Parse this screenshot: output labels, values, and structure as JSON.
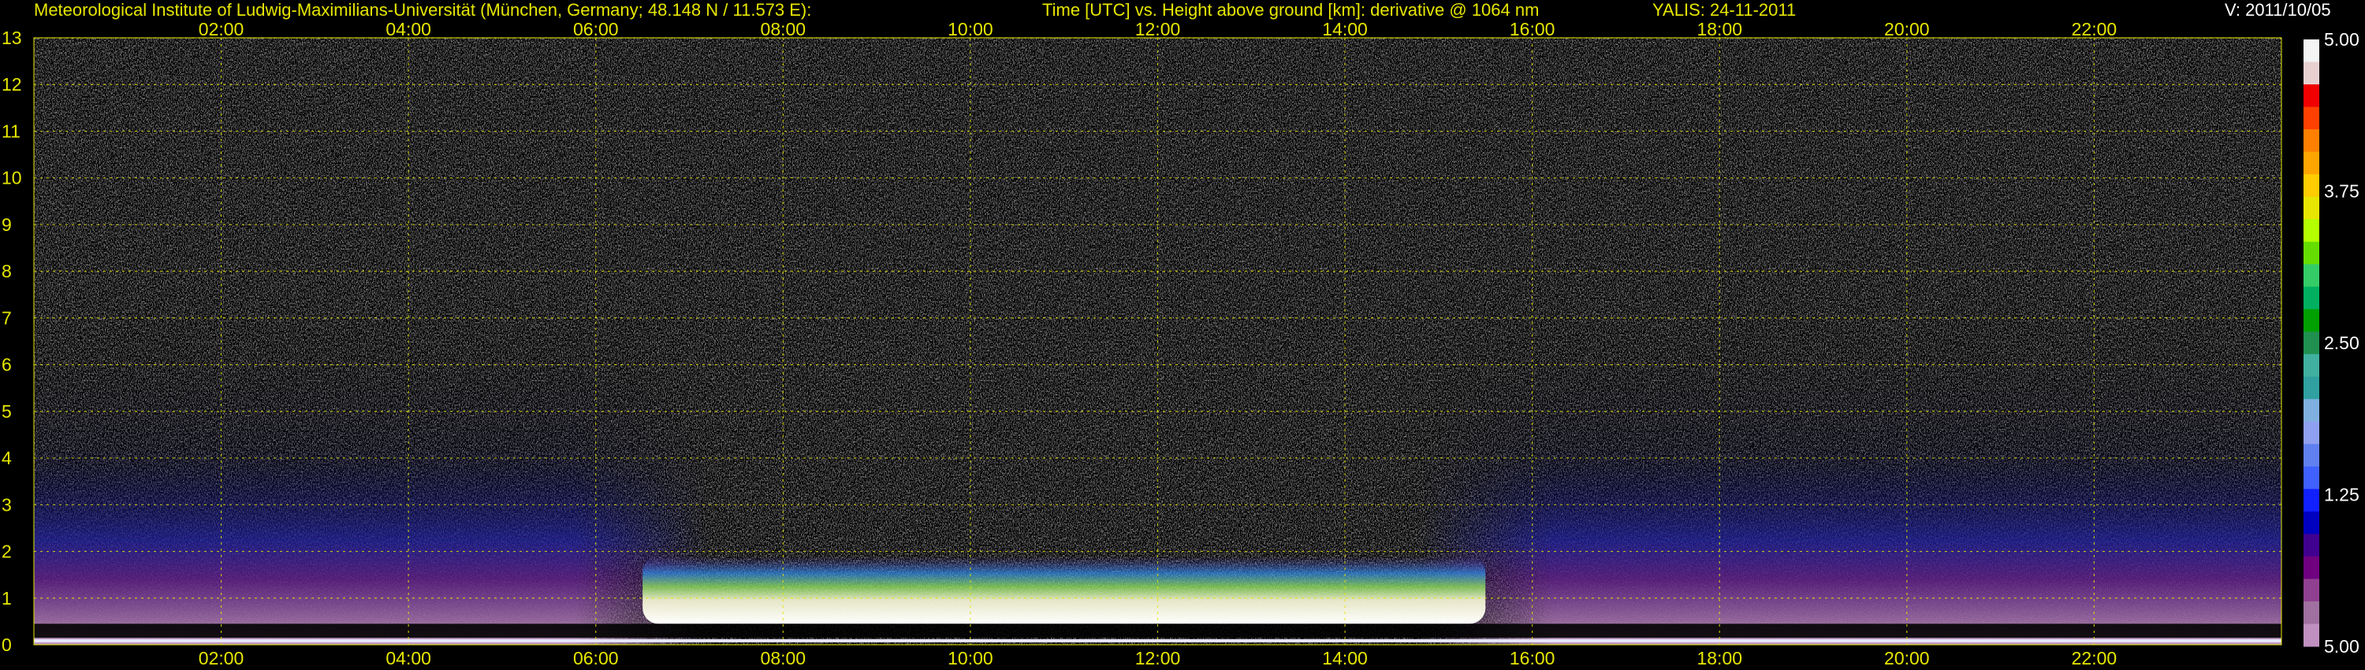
{
  "header": {
    "institute": "Meteorological Institute of Ludwig-Maximilians-Universität (München, Germany; 48.148 N / 11.573 E):",
    "description": "Time [UTC] vs. Height above ground [km]: derivative @ 1064 nm",
    "instrument_date": "YALIS: 24-11-2011",
    "version": "V: 2011/10/05"
  },
  "chart_data": {
    "type": "heatmap",
    "title": "Time [UTC] vs. Height above ground [km]: derivative @ 1064 nm",
    "x_label": "Time [UTC]",
    "y_label": "Height above ground [km]",
    "x_range": [
      "00:00",
      "24:00"
    ],
    "y_range": [
      0,
      13
    ],
    "x_tick_labels": [
      "02:00",
      "04:00",
      "06:00",
      "08:00",
      "10:00",
      "12:00",
      "14:00",
      "16:00",
      "18:00",
      "20:00",
      "22:00"
    ],
    "x_tick_hours": [
      2,
      4,
      6,
      8,
      10,
      12,
      14,
      16,
      18,
      20,
      22
    ],
    "y_tick_labels": [
      "0",
      "1",
      "2",
      "3",
      "4",
      "5",
      "6",
      "7",
      "8",
      "9",
      "10",
      "11",
      "12",
      "13"
    ],
    "y_tick_values": [
      0,
      1,
      2,
      3,
      4,
      5,
      6,
      7,
      8,
      9,
      10,
      11,
      12,
      13
    ],
    "grid": true,
    "grid_color": "#e6e600",
    "colorbar": {
      "labels": [
        "5.00",
        "3.75",
        "2.50",
        "1.25",
        "5.00"
      ],
      "label_values": [
        5.0,
        3.75,
        2.5,
        1.25,
        0.0
      ],
      "colors": [
        "#f4f4f4",
        "#e8d0d0",
        "#f00000",
        "#ff4000",
        "#ff8000",
        "#ffa500",
        "#ffcc00",
        "#e6e600",
        "#b4ff00",
        "#66dd00",
        "#33cc66",
        "#00b060",
        "#00a000",
        "#209050",
        "#40b0a0",
        "#30a0a0",
        "#80b0e0",
        "#90a0f0",
        "#6080f0",
        "#4060ff",
        "#1020ff",
        "#0000c0",
        "#400090",
        "#700080",
        "#904090",
        "#a070a0",
        "#c090c0"
      ]
    },
    "daytime_boundary_layer": {
      "start": "06:30",
      "end": "15:30",
      "top_km": 1.0
    },
    "night_aerosol_top_km": 4.0
  }
}
